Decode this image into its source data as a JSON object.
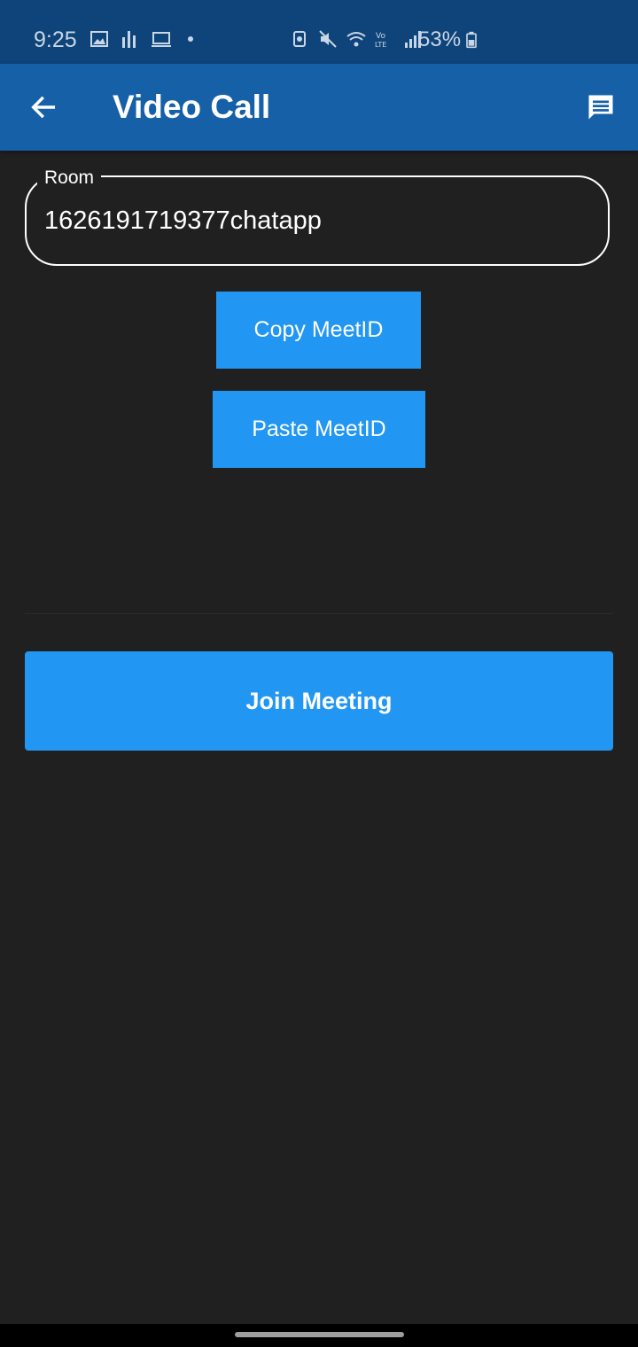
{
  "status_bar": {
    "time": "9:25",
    "battery_percent": "53%",
    "icons_left": [
      "gallery-icon",
      "equalizer-icon",
      "laptop-icon",
      "notification-dot"
    ],
    "icons_right": [
      "alarm-icon",
      "mute-icon",
      "wifi-icon",
      "volte-lte-icon",
      "signal-icon",
      "battery-icon"
    ]
  },
  "app_bar": {
    "title": "Video Call",
    "back_icon": "arrow-left-icon",
    "action_icon": "chat-icon",
    "background": "#1660a8"
  },
  "room_field": {
    "label": "Room",
    "value": "1626191719377chatapp"
  },
  "buttons": {
    "copy_label": "Copy MeetID",
    "paste_label": "Paste MeetID",
    "join_label": "Join Meeting",
    "color": "#2196f3"
  },
  "colors": {
    "background": "#202020",
    "status_bar": "#0e4479"
  }
}
